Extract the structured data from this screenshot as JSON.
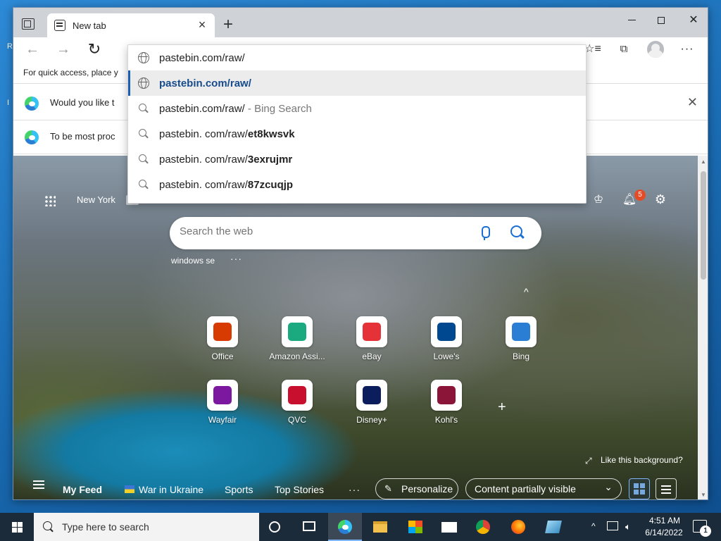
{
  "browser": {
    "tab_title": "New tab",
    "address_text": "pastebin.com/raw/",
    "favorites_bar_text": "For quick access, place y",
    "infobar_1_text": "Would you like t",
    "infobar_2_text": "To be most proc"
  },
  "omnibox": {
    "input_value": "pastebin.com/raw/",
    "suggestions": [
      {
        "icon": "globe-icon",
        "main": "pastebin.com/raw/",
        "sub": ""
      },
      {
        "icon": "search-icon",
        "main": "pastebin.com/raw/",
        "sub": " - Bing Search"
      },
      {
        "icon": "search-icon",
        "prefix": "pastebin. com/raw/",
        "bold": "et8kwsvk"
      },
      {
        "icon": "search-icon",
        "prefix": "pastebin. com/raw/",
        "bold": "3exrujmr"
      },
      {
        "icon": "search-icon",
        "prefix": "pastebin. com/raw/",
        "bold": "87zcuqjp"
      }
    ]
  },
  "ntp": {
    "weather_text": "New York",
    "notification_count": "5",
    "search_placeholder": "Search the web",
    "recent_search": "windows se",
    "recent_more": "···",
    "collapse_chevron": "^",
    "tiles": [
      {
        "label": "Office",
        "color": "#d83b01",
        "icon": "office-icon"
      },
      {
        "label": "Amazon Assi...",
        "color": "#1ba97f",
        "icon": "amazon-assistant-icon"
      },
      {
        "label": "eBay",
        "color": "#e53238",
        "icon": "ebay-icon"
      },
      {
        "label": "Lowe's",
        "color": "#004990",
        "icon": "lowes-icon"
      },
      {
        "label": "Bing",
        "color": "#2a7fd4",
        "icon": "bing-icon"
      },
      {
        "label": "Wayfair",
        "color": "#7b189f",
        "icon": "wayfair-icon"
      },
      {
        "label": "QVC",
        "color": "#c8102e",
        "icon": "qvc-icon"
      },
      {
        "label": "Disney+",
        "color": "#0b1d5c",
        "icon": "disney-plus-icon"
      },
      {
        "label": "Kohl's",
        "color": "#8b1538",
        "icon": "kohls-icon"
      }
    ],
    "like_background": "Like this background?",
    "feed": {
      "my_feed": "My Feed",
      "war_in_ukraine": "War in Ukraine",
      "sports": "Sports",
      "top_stories": "Top Stories",
      "more": "···",
      "personalize": "Personalize",
      "content_visibility": "Content partially visible"
    }
  },
  "taskbar": {
    "search_placeholder": "Type here to search",
    "time": "4:51 AM",
    "date": "6/14/2022",
    "notification_count": "1"
  }
}
